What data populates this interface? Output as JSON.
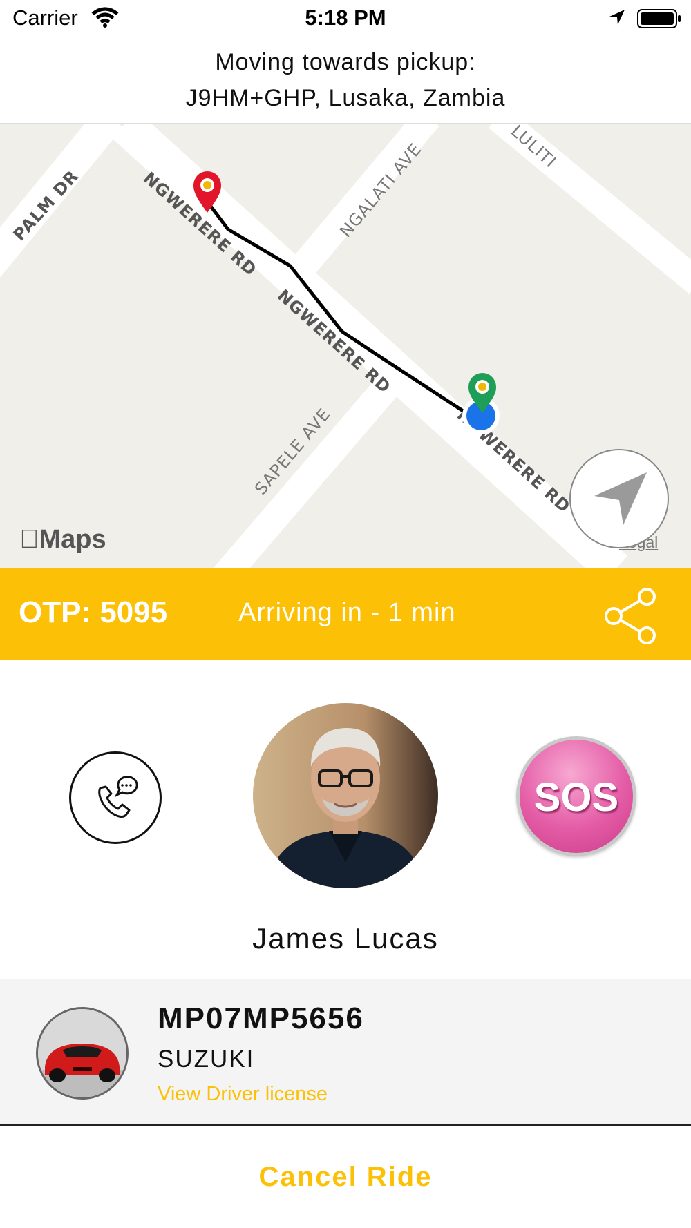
{
  "status_bar": {
    "carrier": "Carrier",
    "time": "5:18 PM"
  },
  "header": {
    "line1": "Moving towards pickup:",
    "line2": "J9HM+GHP, Lusaka, Zambia"
  },
  "map": {
    "streets": [
      "PALM DR",
      "NGWERERE RD",
      "NGALATI AVE",
      "NGWERERE RD",
      "SAPELE AVE",
      "NGWERERE RD",
      "LULITI"
    ],
    "attribution": "Maps",
    "legal": "Legal"
  },
  "otp_bar": {
    "otp": "OTP: 5095",
    "eta": "Arriving in - 1 min"
  },
  "driver": {
    "name": "James Lucas",
    "sos_label": "SOS"
  },
  "vehicle": {
    "plate": "MP07MP5656",
    "make": "SUZUKI",
    "license_link": "View Driver license"
  },
  "actions": {
    "cancel": "Cancel Ride"
  },
  "colors": {
    "accent": "#fcc006",
    "map_bg": "#f1efe9",
    "sos_pink": "#e45ba6"
  },
  "icons": [
    "wifi-icon",
    "location-arrow-icon",
    "battery-icon",
    "pickup-pin-icon",
    "driver-pin-icon",
    "recenter-icon",
    "share-icon",
    "call-chat-icon",
    "sos-icon"
  ]
}
